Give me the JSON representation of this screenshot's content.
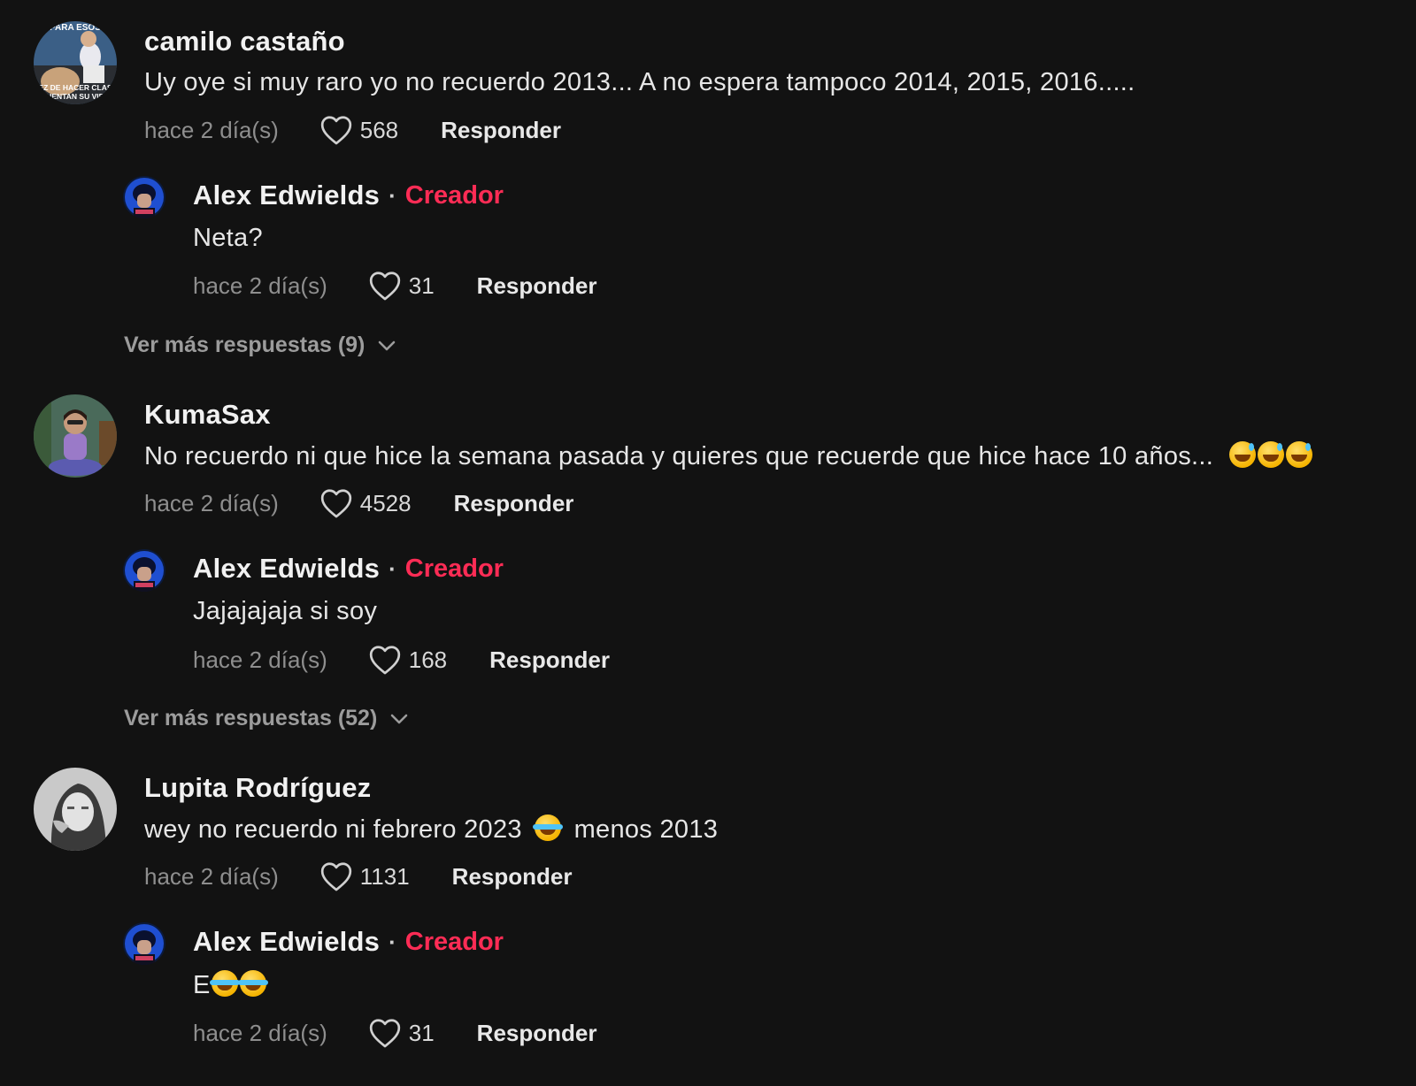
{
  "colors": {
    "background": "#121212",
    "creator_badge": "#fe2c55",
    "secondary_text": "#8e8e8e"
  },
  "comments": [
    {
      "username": "camilo castaño",
      "text": "Uy oye si muy raro yo no recuerdo 2013... A no espera tampoco 2014, 2015, 2016.....",
      "time": "hace 2 día(s)",
      "likes": "568",
      "reply_label": "Responder",
      "creator_reply": {
        "username": "Alex Edwields",
        "badge": "Creador",
        "text": "Neta?",
        "time": "hace 2 día(s)",
        "likes": "31",
        "reply_label": "Responder"
      },
      "more_replies": "Ver más respuestas (9)"
    },
    {
      "username": "KumaSax",
      "text": "No recuerdo ni que hice la semana pasada y quieres que recuerde que hice hace 10 años...",
      "emoji": [
        "grinning-sweat",
        "grinning-sweat",
        "grinning-sweat"
      ],
      "time": "hace 2 día(s)",
      "likes": "4528",
      "reply_label": "Responder",
      "creator_reply": {
        "username": "Alex Edwields",
        "badge": "Creador",
        "text": "Jajajajaja si soy",
        "time": "hace 2 día(s)",
        "likes": "168",
        "reply_label": "Responder"
      },
      "more_replies": "Ver más respuestas (52)"
    },
    {
      "username": "Lupita Rodríguez",
      "text_before": "wey no recuerdo ni febrero 2023",
      "emoji": [
        "tears-of-joy"
      ],
      "text_after": "menos 2013",
      "time": "hace 2 día(s)",
      "likes": "1131",
      "reply_label": "Responder",
      "creator_reply": {
        "username": "Alex Edwields",
        "badge": "Creador",
        "text": "E",
        "emoji": [
          "tears-of-joy",
          "tears-of-joy"
        ],
        "time": "hace 2 día(s)",
        "likes": "31",
        "reply_label": "Responder"
      }
    }
  ],
  "avatar_image_text": {
    "top": "PARA ESOS",
    "bottom": "VEZ DE HACER CLASE CUENTAN SU VIDA"
  }
}
